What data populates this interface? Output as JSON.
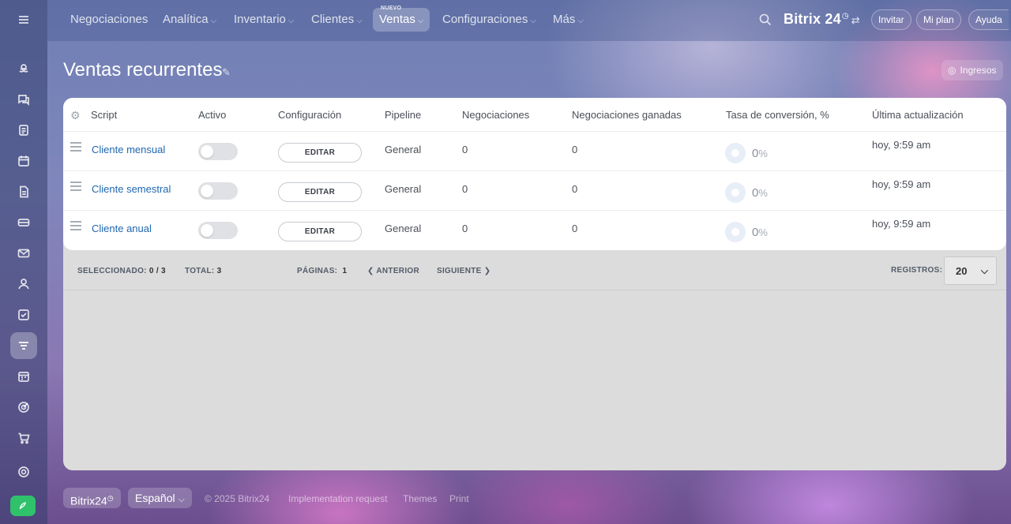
{
  "topnav": {
    "items": [
      {
        "label": "Negociaciones",
        "dropdown": false
      },
      {
        "label": "Analítica",
        "dropdown": true
      },
      {
        "label": "Inventario",
        "dropdown": true
      },
      {
        "label": "Clientes",
        "dropdown": true
      },
      {
        "label": "Ventas",
        "dropdown": true,
        "active": true,
        "badge": "NUEVO"
      },
      {
        "label": "Configuraciones",
        "dropdown": true
      },
      {
        "label": "Más",
        "dropdown": true
      }
    ],
    "new_badge": "NUEVO",
    "logo": "Bitrix 24",
    "invite": "Invitar",
    "plan": "Mi plan",
    "help": "Ayuda"
  },
  "sidebar": {
    "icons": [
      "menu-icon",
      "flower-icon",
      "chat-icon",
      "feed-icon",
      "calendar-icon",
      "document-icon",
      "card-icon",
      "mail-icon",
      "contacts-icon",
      "tasks-icon",
      "crm-funnel-icon",
      "schedule-icon",
      "target-icon",
      "cart-icon",
      "settings-icon",
      "rocket-icon"
    ]
  },
  "page": {
    "title": "Ventas recurrentes",
    "ingresos": "Ingresos"
  },
  "table": {
    "headers": [
      "Script",
      "Activo",
      "Configuración",
      "Pipeline",
      "Negociaciones",
      "Negociaciones ganadas",
      "Tasa de conversión, %",
      "Última actualización"
    ],
    "rows": [
      {
        "script": "Cliente mensual",
        "action": "EDITAR",
        "pipeline": "General",
        "deals": "0",
        "won": "0",
        "conv": "0",
        "pct": "%",
        "updated": "hoy, 9:59 am",
        "active": false
      },
      {
        "script": "Cliente semestral",
        "action": "EDITAR",
        "pipeline": "General",
        "deals": "0",
        "won": "0",
        "conv": "0",
        "pct": "%",
        "updated": "hoy, 9:59 am",
        "active": false
      },
      {
        "script": "Cliente anual",
        "action": "EDITAR",
        "pipeline": "General",
        "deals": "0",
        "won": "0",
        "conv": "0",
        "pct": "%",
        "updated": "hoy, 9:59 am",
        "active": false
      }
    ]
  },
  "pager": {
    "selected_label": "SELECCIONADO:",
    "selected_value": "0 / 3",
    "total_label": "TOTAL:",
    "total_value": "3",
    "pages_label": "PÁGINAS:",
    "pages_value": "1",
    "prev": "ANTERIOR",
    "next": "SIGUIENTE",
    "records_label": "REGISTROS:",
    "records_value": "20"
  },
  "footer": {
    "brand": "Bitrix24",
    "language": "Español",
    "copyright": "© 2025 Bitrix24",
    "implementation": "Implementation request",
    "themes": "Themes",
    "print": "Print"
  }
}
